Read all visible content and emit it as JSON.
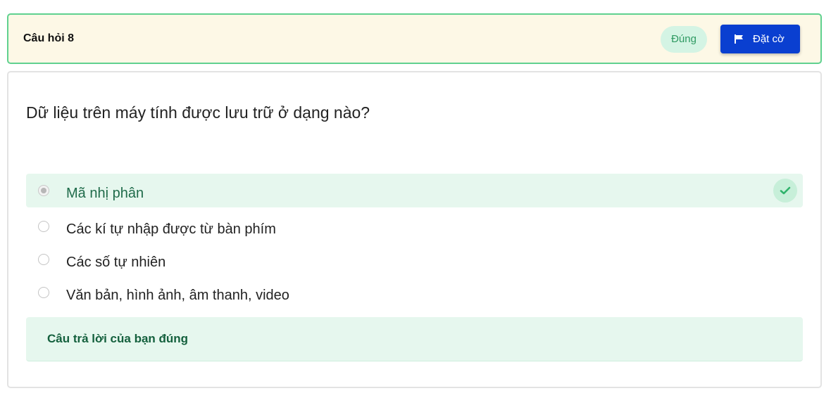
{
  "header": {
    "title": "Câu hỏi 8",
    "status_badge": "Đúng",
    "flag_button_label": "Đặt cờ",
    "flag_icon": "flag-icon"
  },
  "question": {
    "text": "Dữ liệu trên máy tính được lưu trữ ở dạng nào?",
    "options": [
      {
        "label": "Mã nhị phân",
        "selected": true,
        "correct": true
      },
      {
        "label": "Các kí tự nhập được từ bàn phím",
        "selected": false
      },
      {
        "label": "Các số tự nhiên",
        "selected": false
      },
      {
        "label": "Văn bản, hình ảnh, âm thanh, video",
        "selected": false
      }
    ],
    "correct_icon": "check-icon"
  },
  "feedback": {
    "text": "Câu trả lời của bạn đúng"
  },
  "colors": {
    "header_bg": "#fdf8e6",
    "header_border": "#5fd18f",
    "button_blue": "#0a3fd0",
    "correct_bg": "#e6f7ee",
    "correct_text": "#14603d"
  }
}
